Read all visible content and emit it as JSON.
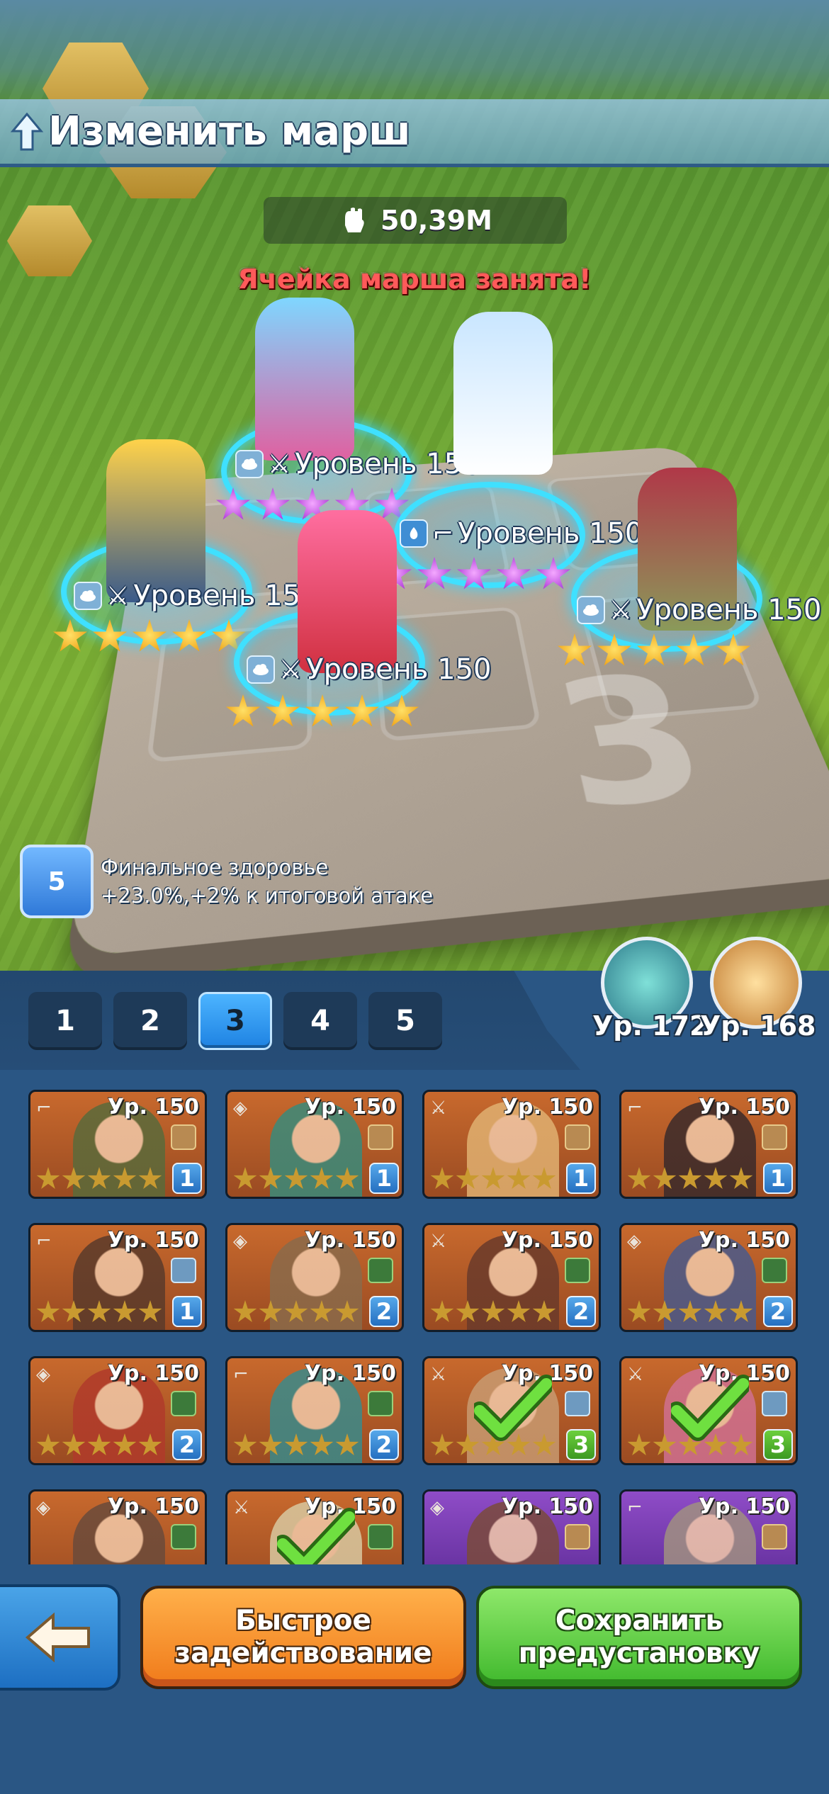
{
  "header": {
    "title": "Изменить марш"
  },
  "power": {
    "value": "50,39M"
  },
  "status": {
    "occupied_message": "Ячейка марша занята!"
  },
  "heroes_on_field": [
    {
      "level_label": "Уровень 150",
      "stars": 5,
      "star_color": "purple"
    },
    {
      "level_label": "Уровень 150",
      "stars": 5,
      "star_color": "purple"
    },
    {
      "level_label": "Уровень 150",
      "stars": 5,
      "star_color": "gold"
    },
    {
      "level_label": "Уровень 150",
      "stars": 5,
      "star_color": "gold"
    },
    {
      "level_label": "Уровень 150",
      "stars": 5,
      "star_color": "gold"
    }
  ],
  "buff": {
    "icon_number": "5",
    "line1": "Финальное здоровье",
    "line2": "+23.0%,+2% к итоговой атаке"
  },
  "tabs": [
    "1",
    "2",
    "3",
    "4",
    "5"
  ],
  "active_tab": "3",
  "beasts": [
    {
      "level": "Ур. 172",
      "icon": "dragon-icon"
    },
    {
      "level": "Ур. 168",
      "icon": "eagle-icon"
    }
  ],
  "roster": [
    {
      "level": "Ур. 150",
      "count": "1",
      "selected": false
    },
    {
      "level": "Ур. 150",
      "count": "1",
      "selected": false
    },
    {
      "level": "Ур. 150",
      "count": "1",
      "selected": false
    },
    {
      "level": "Ур. 150",
      "count": "1",
      "selected": false
    },
    {
      "level": "Ур. 150",
      "count": "1",
      "selected": false
    },
    {
      "level": "Ур. 150",
      "count": "2",
      "selected": false
    },
    {
      "level": "Ур. 150",
      "count": "2",
      "selected": false
    },
    {
      "level": "Ур. 150",
      "count": "2",
      "selected": false
    },
    {
      "level": "Ур. 150",
      "count": "2",
      "selected": false
    },
    {
      "level": "Ур. 150",
      "count": "2",
      "selected": false
    },
    {
      "level": "Ур. 150",
      "count": "3",
      "selected": true
    },
    {
      "level": "Ур. 150",
      "count": "3",
      "selected": true
    },
    {
      "level": "Ур. 150",
      "count": "",
      "selected": false
    },
    {
      "level": "Ур. 150",
      "count": "",
      "selected": true
    },
    {
      "level": "Ур. 150",
      "count": "",
      "selected": false
    },
    {
      "level": "Ур. 150",
      "count": "",
      "selected": false
    }
  ],
  "buttons": {
    "quick_deploy_line1": "Быстрое",
    "quick_deploy_line2": "задействование",
    "save_line1": "Сохранить",
    "save_line2": "предустановку"
  },
  "colors": {
    "ring": "#3fe0ff",
    "quick_button": "#f07a1a",
    "save_button": "#3fb82c",
    "occupied_text": "#ff5a5a"
  }
}
